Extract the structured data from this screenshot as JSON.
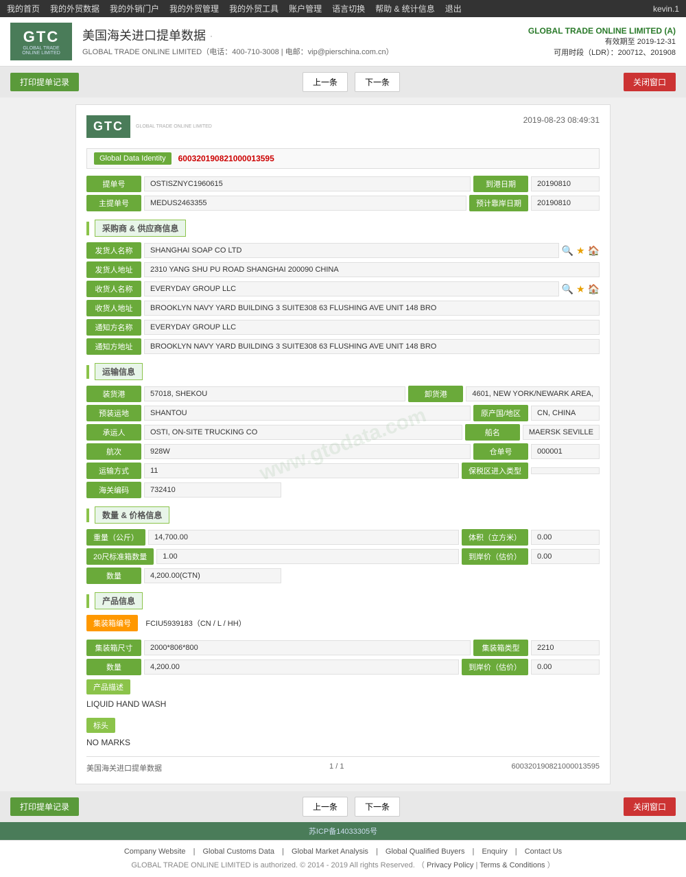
{
  "topnav": {
    "items": [
      "我的首页",
      "我的外贸数据",
      "我的外销门户",
      "我的外贸管理",
      "我的外贸工具",
      "账户管理",
      "语言切换",
      "帮助 & 统计信息",
      "退出"
    ],
    "user": "kevin.1"
  },
  "header": {
    "logo_text": "GTC",
    "logo_sub": "GLOBAL TRADE ONLINE LIMITED",
    "page_title": "美国海关进口提单数据",
    "subtitle": "GLOBAL TRADE ONLINE LIMITED（电话：400-710-3008 | 电邮：vip@pierschina.com.cn）",
    "company": "GLOBAL TRADE ONLINE LIMITED (A)",
    "valid_until_label": "有效期至",
    "valid_until": "2019-12-31",
    "available_time_label": "可用时段（LDR）：200712、201908"
  },
  "actionbar": {
    "print_btn": "打印提单记录",
    "prev_btn": "上一条",
    "next_btn": "下一条",
    "close_btn": "关闭窗口"
  },
  "document": {
    "timestamp": "2019-08-23 08:49:31",
    "gdi_label": "Global Data Identity",
    "gdi_value": "600320190821000013595",
    "fields": {
      "tidan_label": "提单号",
      "tidan_value": "OSTISZNYC1960615",
      "daojin_label": "到港日期",
      "daojin_value": "20190810",
      "zhutidan_label": "主提单号",
      "zhutidan_value": "MEDUS2463355",
      "yujijin_label": "预计靠岸日期",
      "yujijin_value": "20190810"
    },
    "section_supplier": {
      "title": "采购商 & 供应商信息",
      "fahuoren_label": "发货人名称",
      "fahuoren_value": "SHANGHAI SOAP CO LTD",
      "fahuoren_addr_label": "发货人地址",
      "fahuoren_addr_value": "2310 YANG SHU PU ROAD SHANGHAI 200090 CHINA",
      "shouhuo_label": "收货人名称",
      "shouhuo_value": "EVERYDAY GROUP LLC",
      "shouhuo_addr_label": "收货人地址",
      "shouhuo_addr_value": "BROOKLYN NAVY YARD BUILDING 3 SUITE308 63 FLUSHING AVE UNIT 148 BRO",
      "tongzhi_label": "通知方名称",
      "tongzhi_value": "EVERYDAY GROUP LLC",
      "tongzhi_addr_label": "通知方地址",
      "tongzhi_addr_value": "BROOKLYN NAVY YARD BUILDING 3 SUITE308 63 FLUSHING AVE UNIT 148 BRO"
    },
    "section_transport": {
      "title": "运输信息",
      "zhuanghuo_label": "装货港",
      "zhuanghuo_value": "57018, SHEKOU",
      "xiehuо_label": "卸货港",
      "xiehuo_value": "4601, NEW YORK/NEWARK AREA,",
      "yuzhuang_label": "预装运地",
      "yuzhuang_value": "SHANTOU",
      "yuanchan_label": "原产国/地区",
      "yuanchan_value": "CN, CHINA",
      "chengyun_label": "承运人",
      "chengyun_value": "OSTI, ON-SITE TRUCKING CO",
      "chuanming_label": "船名",
      "chuanming_value": "MAERSK SEVILLE",
      "hangci_label": "航次",
      "hangci_value": "928W",
      "cangdan_label": "仓单号",
      "cangdan_value": "000001",
      "yunshufangshi_label": "运输方式",
      "yunshufangshi_value": "11",
      "baoshuiqu_label": "保税区进入类型",
      "baoshuiqu_value": "",
      "haiguanbianhao_label": "海关编码",
      "haiguanbianhao_value": "732410"
    },
    "section_quantity": {
      "title": "数量 & 价格信息",
      "zhongliang_label": "重量（公斤）",
      "zhongliang_value": "14,700.00",
      "tiji_label": "体积（立方米）",
      "tiji_value": "0.00",
      "std20_label": "20尺标准箱数量",
      "std20_value": "1.00",
      "daoanjiage_label": "到岸价（估价）",
      "daoanjiage_value": "0.00",
      "shuliang_label": "数量",
      "shuliang_value": "4,200.00(CTN)"
    },
    "section_product": {
      "title": "产品信息",
      "container_badge_label": "集装箱编号",
      "container_badge_value": "FCIU5939183（CN / L / HH）",
      "size_label": "集装箱尺寸",
      "size_value": "2000*806*800",
      "type_label": "集装箱类型",
      "type_value": "2210",
      "qty_label": "数量",
      "qty_value": "4,200.00",
      "price_label": "到岸价（估价）",
      "price_value": "0.00",
      "desc_label": "产品描述",
      "desc_value": "LIQUID HAND WASH",
      "marks_label": "标头",
      "marks_value": "NO MARKS"
    },
    "doc_footer": {
      "title": "美国海关进口提单数据",
      "page": "1 / 1",
      "gdi": "600320190821000013595"
    }
  },
  "footer": {
    "links": [
      {
        "label": "Company Website",
        "url": "#"
      },
      {
        "label": "Global Customs Data",
        "url": "#"
      },
      {
        "label": "Global Market Analysis",
        "url": "#"
      },
      {
        "label": "Global Qualified Buyers",
        "url": "#"
      },
      {
        "label": "Enquiry",
        "url": "#"
      },
      {
        "label": "Contact Us",
        "url": "#"
      }
    ],
    "copyright": "GLOBAL TRADE ONLINE LIMITED is authorized. © 2014 - 2019 All rights Reserved.",
    "privacy": "Privacy Policy",
    "terms": "Terms & Conditions",
    "icp": "苏ICP备14033305号"
  },
  "watermark": "www.gtodata.com"
}
